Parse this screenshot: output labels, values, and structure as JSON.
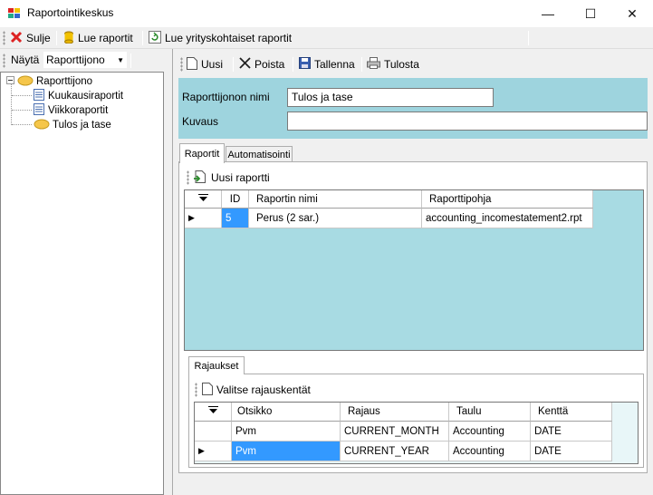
{
  "window": {
    "title": "Raportointikeskus",
    "minimize": "—",
    "maximize": "☐",
    "close": "✕"
  },
  "main_toolbar": {
    "close_label": "Sulje",
    "read_reports_label": "Lue raportit",
    "read_company_reports_label": "Lue yrityskohtaiset raportit"
  },
  "left_toolbar": {
    "show_label": "Näytä",
    "view_select": "Raporttijono"
  },
  "tree": {
    "root": "Raporttijono",
    "children": [
      "Kuukausiraportit",
      "Viikkoraportit",
      "Tulos ja tase"
    ]
  },
  "right_toolbar": {
    "new_label": "Uusi",
    "delete_label": "Poista",
    "save_label": "Tallenna",
    "print_label": "Tulosta"
  },
  "header": {
    "name_label": "Raporttijonon nimi",
    "name_value": "Tulos ja tase",
    "desc_label": "Kuvaus",
    "desc_value": ""
  },
  "tabs": [
    "Raportit",
    "Automatisointi"
  ],
  "reports_toolbar": {
    "new_report_label": "Uusi raportti"
  },
  "reports_grid": {
    "columns": [
      "ID",
      "Raportin nimi",
      "Raporttipohja"
    ],
    "rows": [
      {
        "id": "5",
        "name": "Perus (2 sar.)",
        "template": "accounting_incomestatement2.rpt"
      }
    ]
  },
  "restrictions": {
    "tab_label": "Rajaukset",
    "select_fields_label": "Valitse rajauskentät",
    "columns": [
      "Otsikko",
      "Rajaus",
      "Taulu",
      "Kenttä"
    ],
    "rows": [
      {
        "title": "Pvm",
        "restriction": "CURRENT_MONTH",
        "table": "Accounting",
        "field": "DATE"
      },
      {
        "title": "Pvm",
        "restriction": "CURRENT_YEAR",
        "table": "Accounting",
        "field": "DATE"
      }
    ]
  },
  "colors": {
    "header_bg": "#9ed4de",
    "grid_bg": "#a8dbe3",
    "selection": "#3399ff"
  }
}
